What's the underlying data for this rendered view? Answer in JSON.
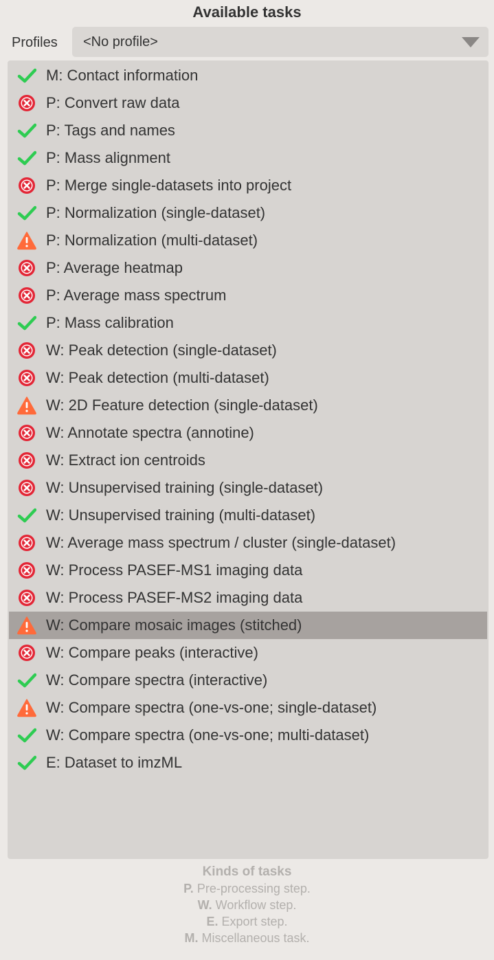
{
  "title": "Available tasks",
  "profiles": {
    "label": "Profiles",
    "selected": "<No profile>"
  },
  "colors": {
    "ok": "#2ecc52",
    "error": "#e32636",
    "warning": "#ff6a3a"
  },
  "tasks": [
    {
      "status": "ok",
      "label": "M: Contact information"
    },
    {
      "status": "error",
      "label": "P: Convert raw data"
    },
    {
      "status": "ok",
      "label": "P: Tags and names"
    },
    {
      "status": "ok",
      "label": "P: Mass alignment"
    },
    {
      "status": "error",
      "label": "P: Merge single-datasets into project"
    },
    {
      "status": "ok",
      "label": "P: Normalization (single-dataset)"
    },
    {
      "status": "warning",
      "label": "P: Normalization (multi-dataset)"
    },
    {
      "status": "error",
      "label": "P: Average heatmap"
    },
    {
      "status": "error",
      "label": "P: Average mass spectrum"
    },
    {
      "status": "ok",
      "label": "P: Mass calibration"
    },
    {
      "status": "error",
      "label": "W: Peak detection (single-dataset)"
    },
    {
      "status": "error",
      "label": "W: Peak detection (multi-dataset)"
    },
    {
      "status": "warning",
      "label": "W: 2D Feature detection (single-dataset)"
    },
    {
      "status": "error",
      "label": "W: Annotate spectra (annotine)"
    },
    {
      "status": "error",
      "label": "W: Extract ion centroids"
    },
    {
      "status": "error",
      "label": "W: Unsupervised training (single-dataset)"
    },
    {
      "status": "ok",
      "label": "W: Unsupervised training (multi-dataset)"
    },
    {
      "status": "error",
      "label": "W: Average mass spectrum / cluster (single-dataset)"
    },
    {
      "status": "error",
      "label": "W: Process PASEF-MS1 imaging data"
    },
    {
      "status": "error",
      "label": "W: Process PASEF-MS2 imaging data"
    },
    {
      "status": "warning",
      "label": "W: Compare mosaic images (stitched)",
      "selected": true
    },
    {
      "status": "error",
      "label": "W: Compare peaks (interactive)"
    },
    {
      "status": "ok",
      "label": "W: Compare spectra (interactive)"
    },
    {
      "status": "warning",
      "label": "W: Compare spectra (one-vs-one; single-dataset)"
    },
    {
      "status": "ok",
      "label": "W: Compare spectra (one-vs-one; multi-dataset)"
    },
    {
      "status": "ok",
      "label": "E: Dataset to imzML"
    }
  ],
  "legend": {
    "heading": "Kinds of tasks",
    "items": [
      {
        "key": "P.",
        "text": "Pre-processing step."
      },
      {
        "key": "W.",
        "text": "Workflow step."
      },
      {
        "key": "E.",
        "text": "Export step."
      },
      {
        "key": "M.",
        "text": "Miscellaneous task."
      }
    ]
  }
}
